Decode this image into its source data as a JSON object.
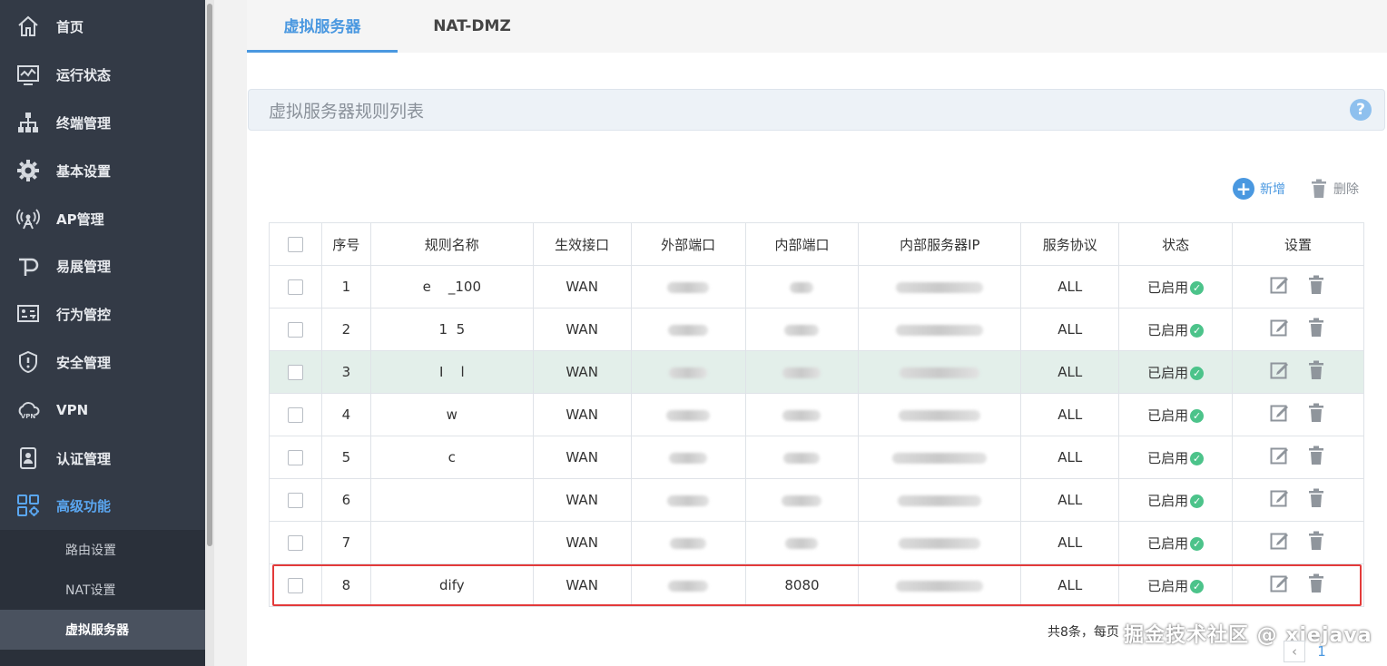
{
  "sidebar": {
    "items": [
      {
        "label": "首页",
        "icon": "home-icon"
      },
      {
        "label": "运行状态",
        "icon": "monitor-icon"
      },
      {
        "label": "终端管理",
        "icon": "network-icon"
      },
      {
        "label": "基本设置",
        "icon": "gear-icon"
      },
      {
        "label": "AP管理",
        "icon": "antenna-icon"
      },
      {
        "label": "易展管理",
        "icon": "p-logo-icon"
      },
      {
        "label": "行为管控",
        "icon": "control-icon"
      },
      {
        "label": "安全管理",
        "icon": "shield-icon"
      },
      {
        "label": "VPN",
        "icon": "vpn-cloud-icon"
      },
      {
        "label": "认证管理",
        "icon": "badge-icon"
      },
      {
        "label": "高级功能",
        "icon": "grid-gear-icon",
        "active": true
      }
    ],
    "submenu": [
      {
        "label": "路由设置"
      },
      {
        "label": "NAT设置"
      },
      {
        "label": "虚拟服务器",
        "active": true
      }
    ]
  },
  "tabs": [
    {
      "label": "虚拟服务器",
      "active": true
    },
    {
      "label": "NAT-DMZ",
      "active": false
    }
  ],
  "section": {
    "title": "虚拟服务器规则列表",
    "help": "?"
  },
  "actions": {
    "add_label": "新增",
    "delete_label": "删除"
  },
  "table": {
    "headers": [
      "序号",
      "规则名称",
      "生效接口",
      "外部端口",
      "内部端口",
      "内部服务器IP",
      "服务协议",
      "状态",
      "设置"
    ],
    "rows": [
      {
        "no": "1",
        "name": "e    _100",
        "iface": "WAN",
        "proto": "ALL",
        "status": "已启用"
      },
      {
        "no": "2",
        "name": "1  5",
        "iface": "WAN",
        "proto": "ALL",
        "status": "已启用"
      },
      {
        "no": "3",
        "name": "I    l",
        "iface": "WAN",
        "proto": "ALL",
        "status": "已启用"
      },
      {
        "no": "4",
        "name": "w",
        "iface": "WAN",
        "proto": "ALL",
        "status": "已启用"
      },
      {
        "no": "5",
        "name": "c",
        "iface": "WAN",
        "proto": "ALL",
        "status": "已启用"
      },
      {
        "no": "6",
        "name": "",
        "iface": "WAN",
        "proto": "ALL",
        "status": "已启用"
      },
      {
        "no": "7",
        "name": "",
        "iface": "WAN",
        "proto": "ALL",
        "status": "已启用"
      },
      {
        "no": "8",
        "name": "dify",
        "iface": "WAN",
        "int_port": "8080",
        "proto": "ALL",
        "status": "已启用"
      }
    ]
  },
  "footer": {
    "summary": "共8条，每页",
    "page": "1"
  },
  "watermark": "掘金技术社区 @ xiejava"
}
